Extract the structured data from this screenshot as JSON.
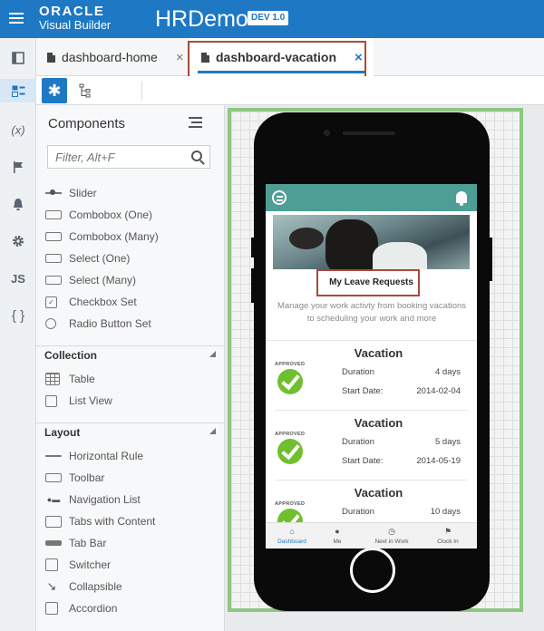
{
  "header": {
    "logo_line1": "ORACLE",
    "logo_line2": "Visual Builder",
    "app_name": "HRDemo",
    "badge": "DEV 1.0"
  },
  "rail": {
    "items": [
      {
        "name": "navigator-icon"
      },
      {
        "name": "pages-icon"
      },
      {
        "name": "variables-icon",
        "glyph": "(x)"
      },
      {
        "name": "flag-icon"
      },
      {
        "name": "bell-icon"
      },
      {
        "name": "settings-icon"
      },
      {
        "name": "js-icon",
        "glyph": "JS"
      },
      {
        "name": "json-icon",
        "glyph": "{ }"
      }
    ]
  },
  "tabs": [
    {
      "label": "dashboard-home",
      "close": "×"
    },
    {
      "label": "dashboard-vacation",
      "close": "×"
    }
  ],
  "toolbar": {
    "design_glyph": "✱"
  },
  "components": {
    "title": "Components",
    "filter_placeholder": "Filter, Alt+F",
    "items": [
      {
        "label": "Slider"
      },
      {
        "label": "Combobox (One)"
      },
      {
        "label": "Combobox (Many)"
      },
      {
        "label": "Select (One)"
      },
      {
        "label": "Select (Many)"
      },
      {
        "label": "Checkbox Set"
      },
      {
        "label": "Radio Button Set"
      }
    ],
    "sections": [
      {
        "label": "Collection",
        "items": [
          {
            "label": "Table"
          },
          {
            "label": "List View"
          }
        ]
      },
      {
        "label": "Layout",
        "items": [
          {
            "label": "Horizontal Rule"
          },
          {
            "label": "Toolbar"
          },
          {
            "label": "Navigation List"
          },
          {
            "label": "Tabs with Content"
          },
          {
            "label": "Tab Bar"
          },
          {
            "label": "Switcher"
          },
          {
            "label": "Collapsible"
          },
          {
            "label": "Accordion"
          }
        ]
      }
    ]
  },
  "mobile": {
    "title": "My Leave Requests",
    "description": "Manage your work activty from booking vacations to scheduling your work and more",
    "vacations": [
      {
        "title": "Vacation",
        "status": "APPROVED",
        "duration_label": "Duration",
        "duration": "4 days",
        "start_label": "Start Date:",
        "start": "2014-02-04"
      },
      {
        "title": "Vacation",
        "status": "APPROVED",
        "duration_label": "Duration",
        "duration": "5 days",
        "start_label": "Start Date:",
        "start": "2014-05-19"
      },
      {
        "title": "Vacation",
        "status": "APPROVED",
        "duration_label": "Duration",
        "duration": "10 days",
        "start_label": "",
        "start": ""
      }
    ],
    "nav": [
      {
        "label": "Dashboard",
        "icon": "home-icon"
      },
      {
        "label": "Me",
        "icon": "person-icon"
      },
      {
        "label": "Next in Work",
        "icon": "clock-icon"
      },
      {
        "label": "Clock In",
        "icon": "flag-icon"
      }
    ]
  },
  "colors": {
    "brand": "#1e78c4",
    "teal": "#4f9e95",
    "approved": "#6fbf2e",
    "frame": "#8ec682",
    "highlight": "#a84a3a"
  }
}
